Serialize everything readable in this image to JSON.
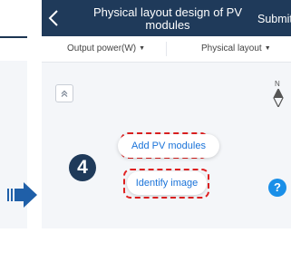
{
  "header": {
    "title": "Physical layout design of PV modules",
    "submit_label": "Submit",
    "back_icon": "chevron-left-icon"
  },
  "toolbar": {
    "output_power": "Output power(W)",
    "physical_layout": "Physical layout",
    "caret": "▼"
  },
  "canvas": {
    "collapse_icon": "chevron-up-icon",
    "compass_label": "N",
    "add_modules_label": "Add PV modules",
    "identify_image_label": "Identify image",
    "help_label": "?"
  },
  "annotation": {
    "step_number": "4",
    "highlight_color": "#e02020"
  },
  "colors": {
    "header_bg": "#1f3a5a",
    "accent_blue": "#1a73d9",
    "help_blue": "#1a8fe8",
    "canvas_bg": "#f4f6f9"
  }
}
